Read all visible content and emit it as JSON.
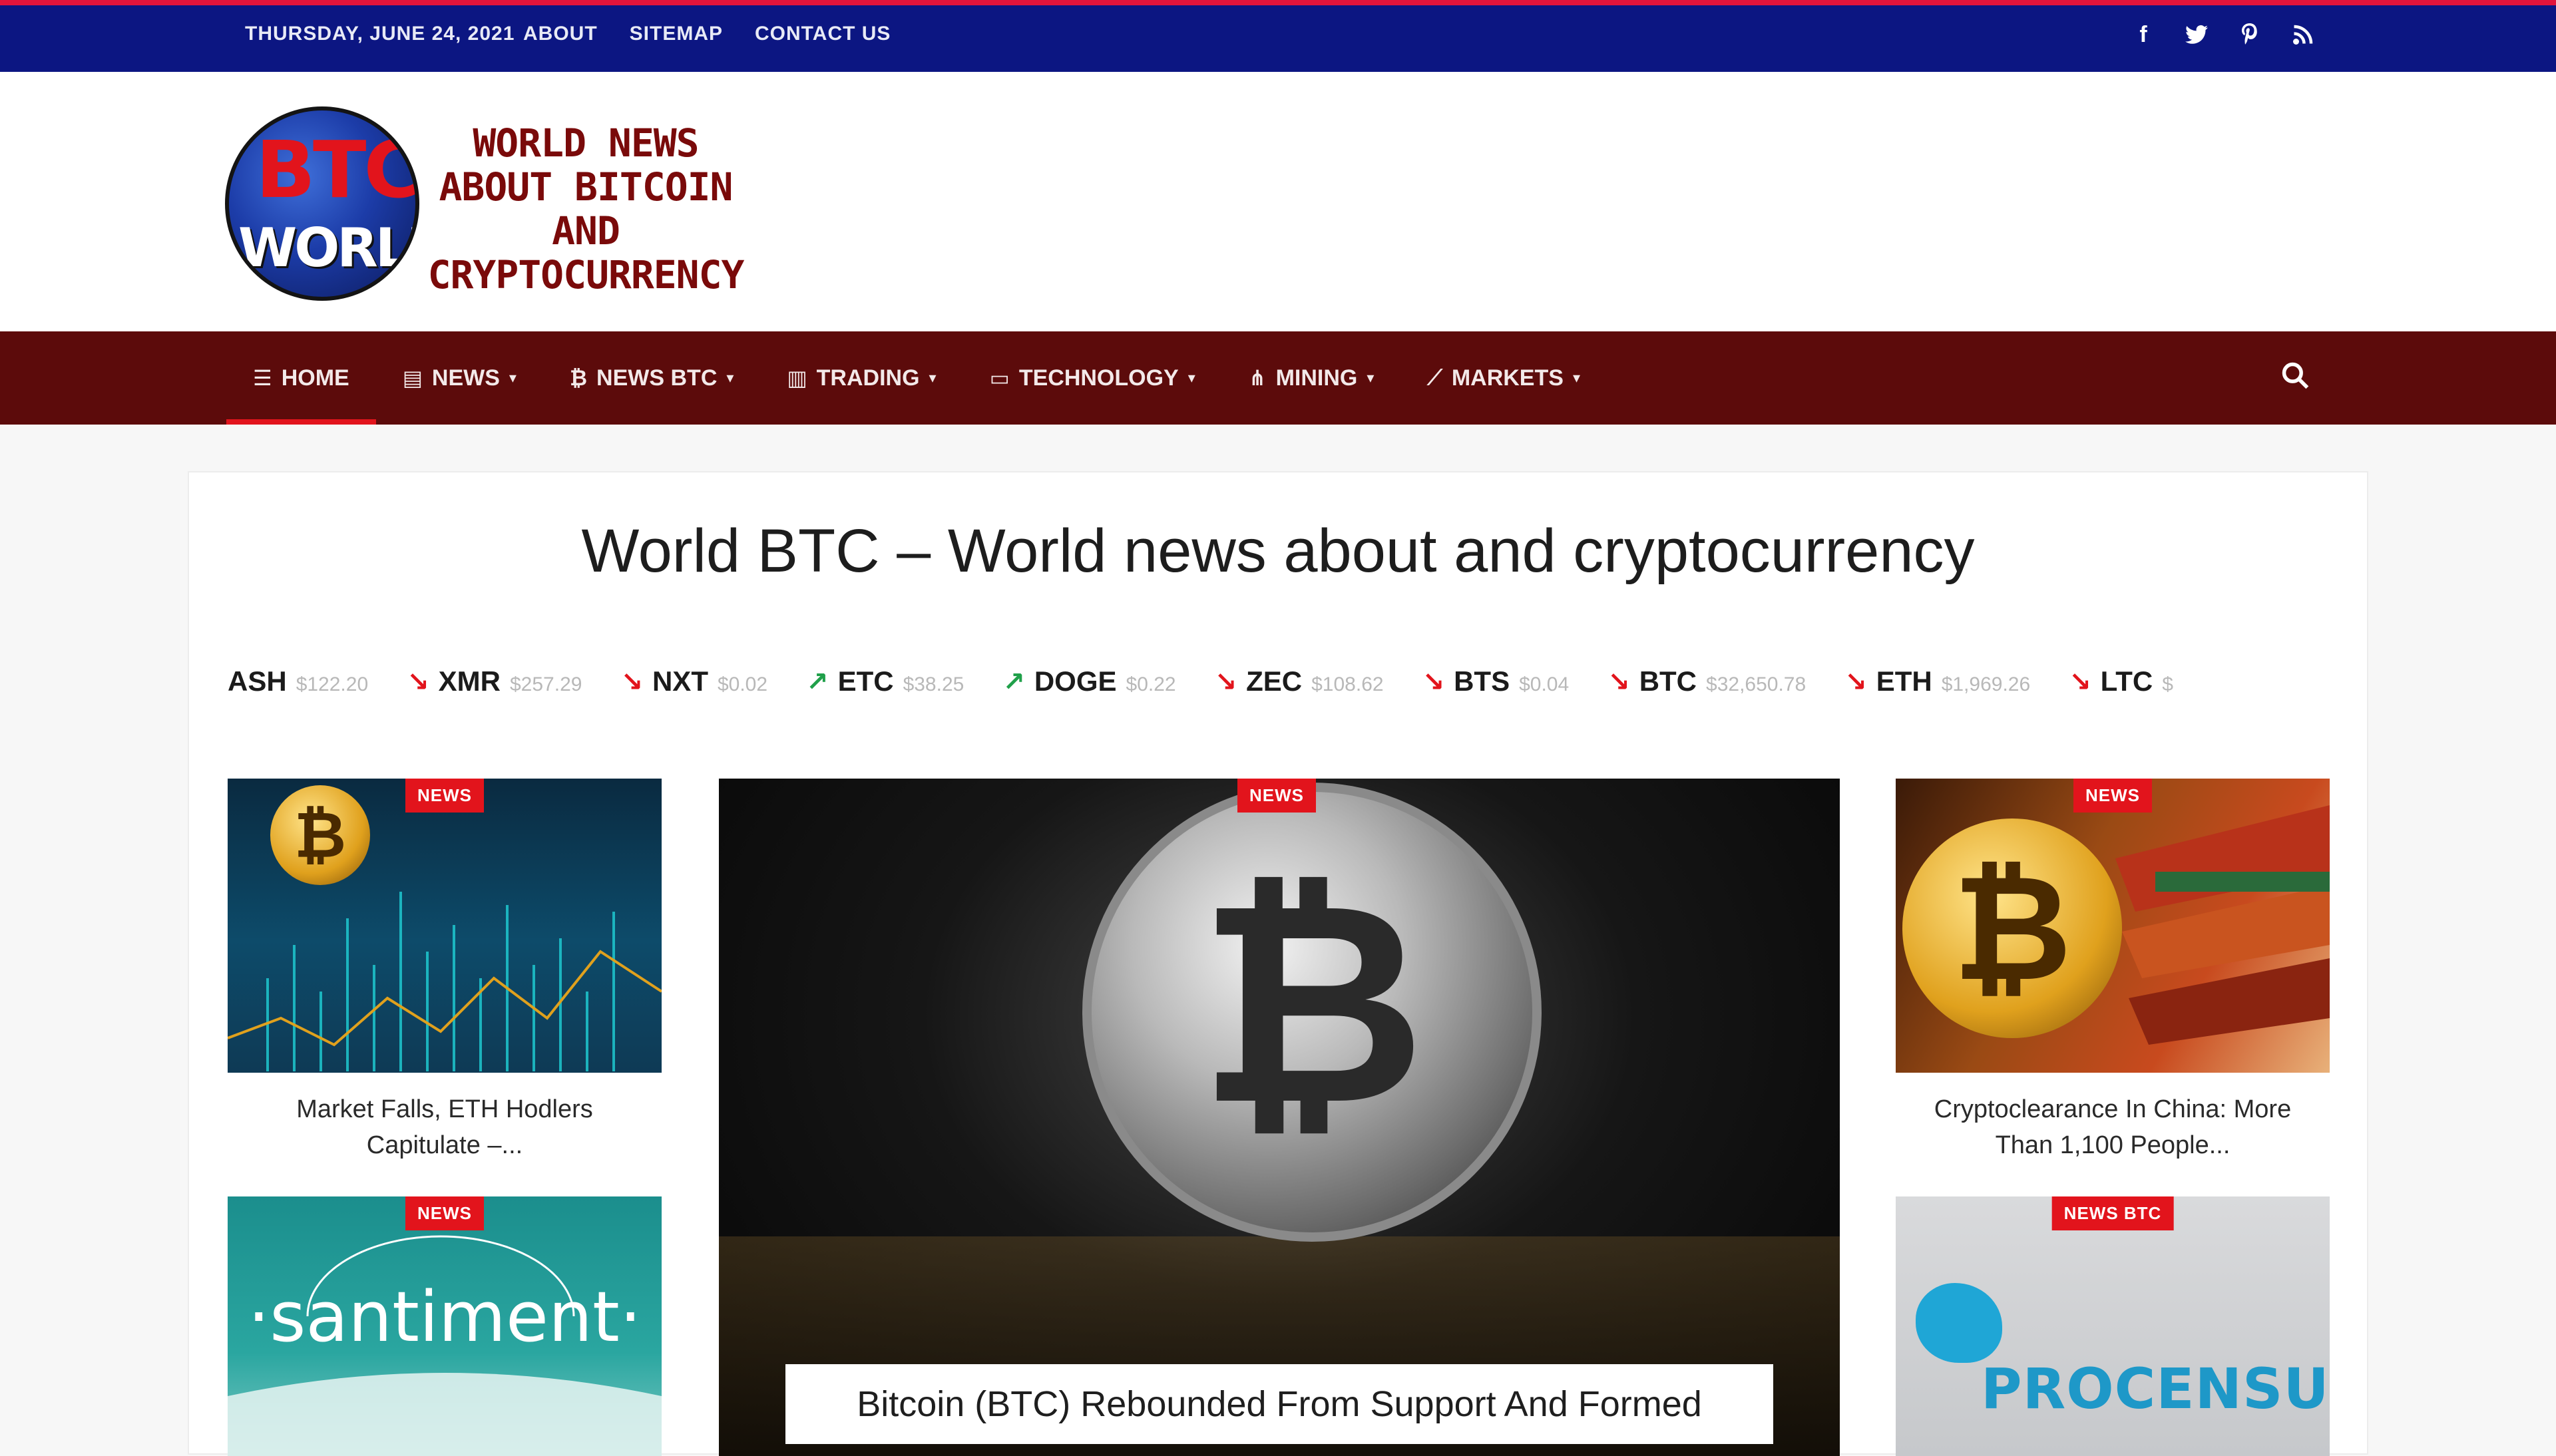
{
  "topbar": {
    "date": "THURSDAY, JUNE 24, 2021",
    "links": [
      "ABOUT",
      "SITEMAP",
      "CONTACT US"
    ],
    "social_icons": [
      "facebook-icon",
      "twitter-icon",
      "pinterest-icon",
      "rss-icon"
    ]
  },
  "logo": {
    "mark_top": "BTC",
    "mark_bottom": "WORLD",
    "tagline_lines": [
      "WORLD NEWS",
      "ABOUT BITCOIN",
      "AND",
      "CRYPTOCURRENCY"
    ]
  },
  "nav": {
    "items": [
      {
        "label": "HOME",
        "icon": "menu-icon",
        "dropdown": false,
        "active": true
      },
      {
        "label": "NEWS",
        "icon": "newspaper-icon",
        "dropdown": true
      },
      {
        "label": "NEWS BTC",
        "icon": "bitcoin-icon",
        "dropdown": true
      },
      {
        "label": "TRADING",
        "icon": "bar-chart-icon",
        "dropdown": true
      },
      {
        "label": "TECHNOLOGY",
        "icon": "monitor-icon",
        "dropdown": true
      },
      {
        "label": "MINING",
        "icon": "sitemap-icon",
        "dropdown": true
      },
      {
        "label": "MARKETS",
        "icon": "line-chart-icon",
        "dropdown": true
      }
    ],
    "search_icon": "search-icon"
  },
  "page": {
    "title": "World BTC – World news about and cryptocurrency"
  },
  "ticker": [
    {
      "symbol": "ASH",
      "price": "$122.20",
      "direction": "none"
    },
    {
      "symbol": "XMR",
      "price": "$257.29",
      "direction": "down"
    },
    {
      "symbol": "NXT",
      "price": "$0.02",
      "direction": "down"
    },
    {
      "symbol": "ETC",
      "price": "$38.25",
      "direction": "up"
    },
    {
      "symbol": "DOGE",
      "price": "$0.22",
      "direction": "up"
    },
    {
      "symbol": "ZEC",
      "price": "$108.62",
      "direction": "down"
    },
    {
      "symbol": "BTS",
      "price": "$0.04",
      "direction": "down"
    },
    {
      "symbol": "BTC",
      "price": "$32,650.78",
      "direction": "down"
    },
    {
      "symbol": "ETH",
      "price": "$1,969.26",
      "direction": "down"
    },
    {
      "symbol": "LTC",
      "price": "$",
      "direction": "down"
    }
  ],
  "articles": {
    "left_top": {
      "badge": "NEWS",
      "caption_lines": [
        "Market Falls, ETH Hodlers",
        "Capitulate –..."
      ]
    },
    "left_bottom": {
      "badge": "NEWS",
      "image_text": "·santiment·"
    },
    "hero": {
      "badge": "NEWS",
      "caption": "Bitcoin (BTC) Rebounded From Support And Formed"
    },
    "right_top": {
      "badge": "NEWS",
      "caption_lines": [
        "Cryptoclearance In China: More",
        "Than 1,100 People..."
      ]
    },
    "right_bottom": {
      "badge": "NEWS BTC",
      "image_text": "PROCENSUS"
    }
  },
  "colors": {
    "topbar_bg": "#0c1682",
    "topbar_accent": "#e2143c",
    "nav_bg": "#5c0b0b",
    "badge": "#e2141c",
    "logo_text": "#7a0a0a"
  }
}
